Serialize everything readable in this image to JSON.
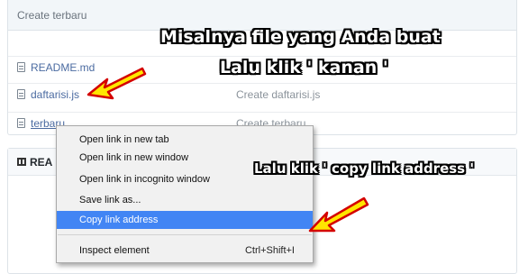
{
  "header": {
    "commit_message": "Create terbaru"
  },
  "files": [
    {
      "name": "README.md",
      "commit": ""
    },
    {
      "name": "daftarisi.js",
      "commit": "Create daftarisi.js"
    },
    {
      "name": "terbaru",
      "commit": "Create terbaru"
    }
  ],
  "readme": {
    "title": "REA"
  },
  "context_menu": {
    "items": [
      {
        "label": "Open link in new tab",
        "shortcut": ""
      },
      {
        "label": "Open link in new window",
        "shortcut": ""
      },
      {
        "label": "Open link in incognito window",
        "shortcut": ""
      },
      {
        "label": "Save link as...",
        "shortcut": ""
      },
      {
        "label": "Copy link address",
        "shortcut": ""
      },
      {
        "label": "Inspect element",
        "shortcut": "Ctrl+Shift+I"
      }
    ],
    "selected_index": 4
  },
  "annotations": {
    "line1": "Misalnya file yang Anda buat",
    "line2": "Lalu klik ' kanan '",
    "line3": "Lalu klik ' copy link address '"
  },
  "colors": {
    "link": "#4b6ba1",
    "menu_highlight": "#4285f4",
    "arrow_fill": "#ffe600",
    "arrow_outline": "#d40000"
  },
  "icons": [
    "file-icon",
    "book-icon",
    "arrow-icon"
  ]
}
